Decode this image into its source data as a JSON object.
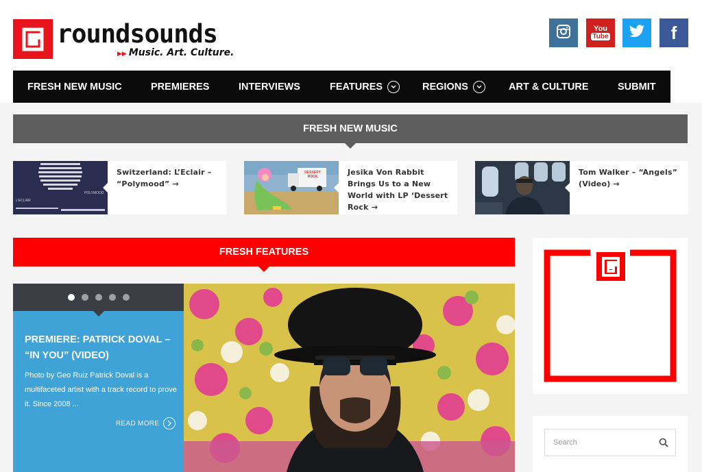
{
  "brand": {
    "logo_letter": "G",
    "name": "roundsounds",
    "tagline_arrows": "▶▶",
    "tagline": "Music. Art. Culture.",
    "accent_color": "#e8141b"
  },
  "social": [
    {
      "name": "instagram",
      "icon": "instagram-icon",
      "color": "#3f729b"
    },
    {
      "name": "youtube",
      "icon": "youtube-icon",
      "color": "#cd201f",
      "label_top": "You",
      "label_bottom": "Tube"
    },
    {
      "name": "twitter",
      "icon": "twitter-icon",
      "color": "#1da1f2"
    },
    {
      "name": "facebook",
      "icon": "facebook-icon",
      "color": "#3b5998",
      "label": "f"
    }
  ],
  "nav": {
    "items": [
      {
        "label": "FRESH NEW MUSIC"
      },
      {
        "label": "PREMIERES"
      },
      {
        "label": "INTERVIEWS"
      },
      {
        "label": "FEATURES",
        "dropdown": true
      },
      {
        "label": "REGIONS",
        "dropdown": true
      },
      {
        "label": "ART & CULTURE"
      },
      {
        "label": "SUBMIT"
      }
    ]
  },
  "fresh_music": {
    "heading": "FRESH NEW MUSIC",
    "bar_color": "#5d5d5d",
    "cards": [
      {
        "title": "Switzerland: L’Eclair – “Polymood” →",
        "thumb_text_left": "L'ECLAIR",
        "thumb_text_right": "POLYMOOD"
      },
      {
        "title": "Jesika Von Rabbit Brings Us to a New World with LP ‘Dessert Rock →",
        "thumb_truck_text": "DESSERT ROCK"
      },
      {
        "title": "Tom Walker – “Angels” (Video) →"
      }
    ]
  },
  "features": {
    "heading": "FRESH FEATURES",
    "bar_color": "#ff0000",
    "slide_count": 5,
    "active_slide": 1,
    "title": "PREMIERE: PATRICK DOVAL – “IN YOU” (VIDEO)",
    "excerpt": "Photo by Geo Ruiz Patrick Doval is a multifaceted artist with a track record to prove it. Since 2008 ...",
    "read_more": "READ MORE",
    "panel_color": "#3fa3d8"
  },
  "sidebar": {
    "logo_letter": "G",
    "search_placeholder": "Search"
  }
}
